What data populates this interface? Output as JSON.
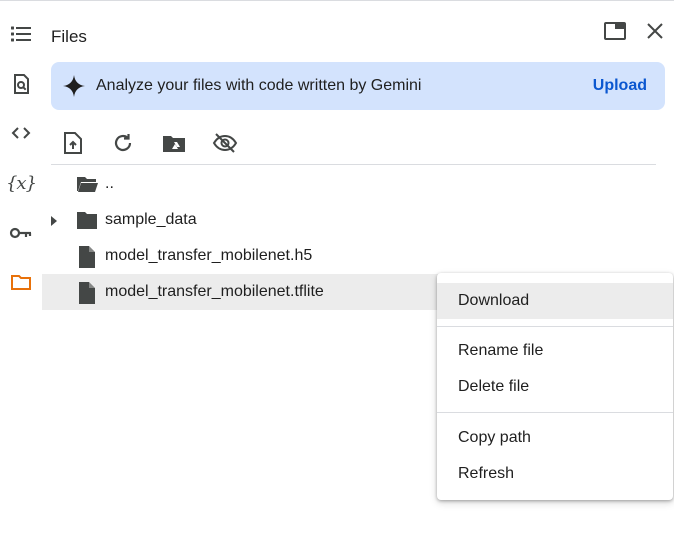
{
  "panel": {
    "title": "Files"
  },
  "rail": {
    "items": [
      {
        "icon": "table-of-contents-icon"
      },
      {
        "icon": "find-replace-icon"
      },
      {
        "icon": "code-snippets-icon"
      },
      {
        "icon": "variables-icon",
        "text": "{x}"
      },
      {
        "icon": "secrets-key-icon"
      },
      {
        "icon": "folder-icon",
        "active": true
      }
    ]
  },
  "header": {
    "icons": [
      "open-in-tab-icon",
      "close-icon"
    ]
  },
  "banner": {
    "text": "Analyze your files with code written by Gemini",
    "link": "Upload"
  },
  "toolbar": {
    "icons": [
      "upload-file-icon",
      "refresh-icon",
      "mount-drive-icon",
      "hide-hidden-files-icon"
    ]
  },
  "tree": [
    {
      "label": "..",
      "type": "folder-open",
      "expandable": false
    },
    {
      "label": "sample_data",
      "type": "folder",
      "expandable": true
    },
    {
      "label": "model_transfer_mobilenet.h5",
      "type": "file",
      "expandable": false
    },
    {
      "label": "model_transfer_mobilenet.tflite",
      "type": "file",
      "expandable": false,
      "selected": true
    }
  ],
  "context_menu": {
    "items": [
      {
        "label": "Download"
      },
      {
        "label": "Rename file"
      },
      {
        "label": "Delete file"
      },
      {
        "label": "Copy path"
      },
      {
        "label": "Refresh"
      }
    ]
  },
  "colors": {
    "accent": "#e8710a",
    "banner_bg": "#d3e3fd",
    "link": "#0b57d0",
    "selected_row": "#ececec"
  }
}
